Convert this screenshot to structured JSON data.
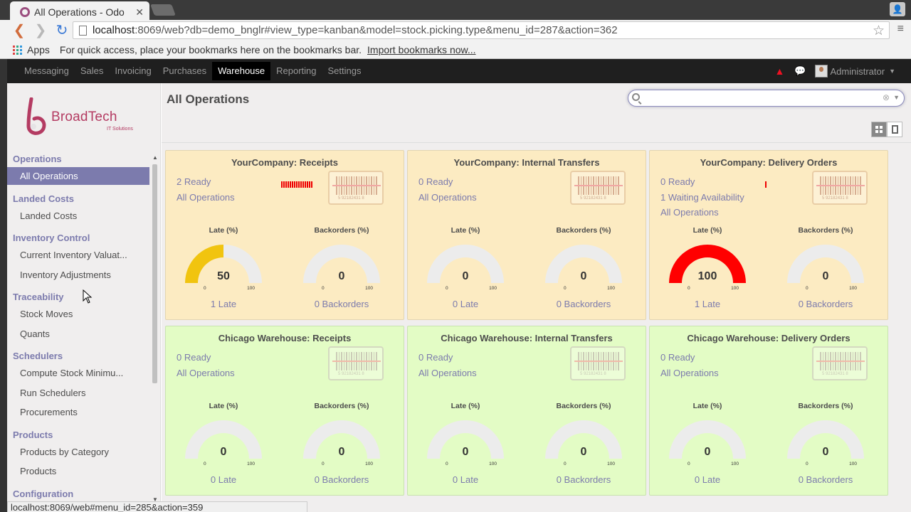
{
  "browser": {
    "tab_title": "All Operations - Odo",
    "url_host": "localhost",
    "url_rest": ":8069/web?db=demo_bnglr#view_type=kanban&model=stock.picking.type&menu_id=287&action=362",
    "bookmarks": {
      "apps_label": "Apps",
      "hint": "For quick access, place your bookmarks here on the bookmarks bar.",
      "import_link": "Import bookmarks now..."
    },
    "status_url": "localhost:8069/web#menu_id=285&action=359"
  },
  "topbar": {
    "menu": [
      "Messaging",
      "Sales",
      "Invoicing",
      "Purchases",
      "Warehouse",
      "Reporting",
      "Settings"
    ],
    "active": "Warehouse",
    "user": "Administrator"
  },
  "logo": {
    "name": "BroadTech",
    "tagline": "IT Solutions",
    "brand_color": "#b43b62"
  },
  "sidebar": {
    "sections": [
      {
        "title": "Operations",
        "items": [
          "All Operations"
        ]
      },
      {
        "title": "Landed Costs",
        "items": [
          "Landed Costs"
        ]
      },
      {
        "title": "Inventory Control",
        "items": [
          "Current Inventory Valuat...",
          "Inventory Adjustments"
        ]
      },
      {
        "title": "Traceability",
        "items": [
          "Stock Moves",
          "Quants"
        ]
      },
      {
        "title": "Schedulers",
        "items": [
          "Compute Stock Minimu...",
          "Run Schedulers",
          "Procurements"
        ]
      },
      {
        "title": "Products",
        "items": [
          "Products by Category",
          "Products"
        ]
      },
      {
        "title": "Configuration",
        "items": []
      }
    ],
    "active_item": "All Operations",
    "accent_color": "#7c7bad"
  },
  "main": {
    "title": "All Operations",
    "search_value": "",
    "cards": [
      {
        "title": "YourCompany: Receipts",
        "color": "amber",
        "links": [
          "2 Ready",
          "All Operations"
        ],
        "sparkline_bars": 15,
        "barcode_text": "5 92182431 8",
        "late": {
          "label": "Late (%)",
          "value": 50,
          "min": "0",
          "max": "100",
          "footer": "1 Late",
          "color": "#f1c40f"
        },
        "backorders": {
          "label": "Backorders (%)",
          "value": 0,
          "min": "0",
          "max": "100",
          "footer": "0 Backorders",
          "color": "#f1c40f"
        }
      },
      {
        "title": "YourCompany: Internal Transfers",
        "color": "amber",
        "links": [
          "0 Ready",
          "All Operations"
        ],
        "sparkline_bars": 0,
        "barcode_text": "5 92182431 8",
        "late": {
          "label": "Late (%)",
          "value": 0,
          "min": "0",
          "max": "100",
          "footer": "0 Late",
          "color": "#f1c40f"
        },
        "backorders": {
          "label": "Backorders (%)",
          "value": 0,
          "min": "0",
          "max": "100",
          "footer": "0 Backorders",
          "color": "#f1c40f"
        }
      },
      {
        "title": "YourCompany: Delivery Orders",
        "color": "amber",
        "links": [
          "0 Ready",
          "1 Waiting Availability",
          "All Operations"
        ],
        "sparkline_bars": 1,
        "barcode_text": "5 92182431 8",
        "late": {
          "label": "Late (%)",
          "value": 100,
          "min": "0",
          "max": "100",
          "footer": "1 Late",
          "color": "#ff0000"
        },
        "backorders": {
          "label": "Backorders (%)",
          "value": 0,
          "min": "0",
          "max": "100",
          "footer": "0 Backorders",
          "color": "#f1c40f"
        }
      },
      {
        "title": "Chicago Warehouse: Receipts",
        "color": "green",
        "links": [
          "0 Ready",
          "All Operations"
        ],
        "sparkline_bars": 0,
        "barcode_text": "5 92182431 8",
        "late": {
          "label": "Late (%)",
          "value": 0,
          "min": "0",
          "max": "100",
          "footer": "0 Late",
          "color": "#f1c40f"
        },
        "backorders": {
          "label": "Backorders (%)",
          "value": 0,
          "min": "0",
          "max": "100",
          "footer": "0 Backorders",
          "color": "#f1c40f"
        }
      },
      {
        "title": "Chicago Warehouse: Internal Transfers",
        "color": "green",
        "links": [
          "0 Ready",
          "All Operations"
        ],
        "sparkline_bars": 0,
        "barcode_text": "5 92182431 8",
        "late": {
          "label": "Late (%)",
          "value": 0,
          "min": "0",
          "max": "100",
          "footer": "0 Late",
          "color": "#f1c40f"
        },
        "backorders": {
          "label": "Backorders (%)",
          "value": 0,
          "min": "0",
          "max": "100",
          "footer": "0 Backorders",
          "color": "#f1c40f"
        }
      },
      {
        "title": "Chicago Warehouse: Delivery Orders",
        "color": "green",
        "links": [
          "0 Ready",
          "All Operations"
        ],
        "sparkline_bars": 0,
        "barcode_text": "5 92182431 8",
        "late": {
          "label": "Late (%)",
          "value": 0,
          "min": "0",
          "max": "100",
          "footer": "0 Late",
          "color": "#f1c40f"
        },
        "backorders": {
          "label": "Backorders (%)",
          "value": 0,
          "min": "0",
          "max": "100",
          "footer": "0 Backorders",
          "color": "#f1c40f"
        }
      }
    ]
  },
  "icons": {
    "tab": "odoo-favicon",
    "back": "arrow-left-icon",
    "forward": "arrow-right-icon",
    "reload": "reload-icon",
    "star": "star-icon",
    "alert": "warning-icon",
    "chat": "chat-icon",
    "search": "search-icon",
    "barcode": "barcode-icon"
  }
}
